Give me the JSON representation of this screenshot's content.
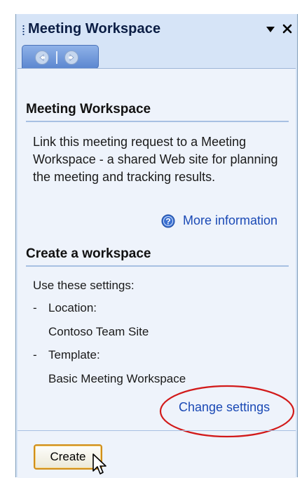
{
  "pane": {
    "title": "Meeting Workspace"
  },
  "nav": {
    "back_icon": "back-arrow-icon",
    "forward_icon": "forward-arrow-icon"
  },
  "section1": {
    "header": "Meeting Workspace",
    "description": "Link this meeting request to a Meeting Workspace - a shared Web site for planning the meeting and tracking results.",
    "more_info": "More information"
  },
  "section2": {
    "header": "Create a workspace",
    "intro": "Use these settings:",
    "location_label": "Location:",
    "location_value": "Contoso Team Site",
    "template_label": "Template:",
    "template_value": "Basic Meeting Workspace",
    "change_settings": "Change settings",
    "create_button": "Create"
  },
  "colors": {
    "pane_bg": "#d6e4f7",
    "content_bg": "#eef3fb",
    "link": "#1a49b5",
    "annotation": "#d21a1a",
    "button_border": "#d08e1a"
  }
}
